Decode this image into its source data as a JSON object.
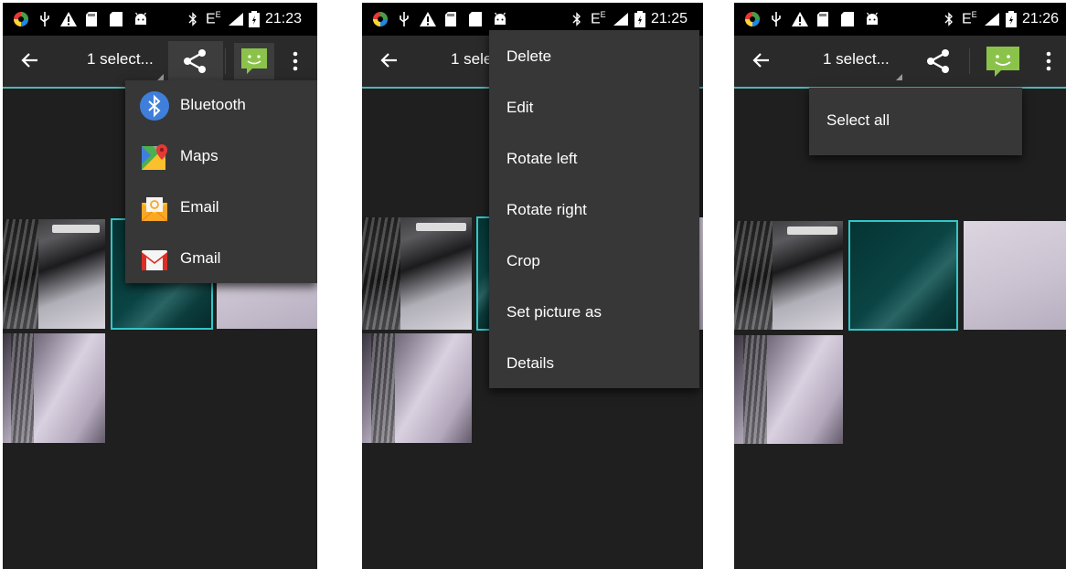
{
  "screens": [
    {
      "status": {
        "time": "21:23",
        "network": "E",
        "network_sup": "E"
      },
      "actionbar": {
        "title": "1 select..."
      },
      "share_menu": {
        "items": [
          {
            "label": "Bluetooth",
            "icon": "bluetooth-icon"
          },
          {
            "label": "Maps",
            "icon": "maps-icon"
          },
          {
            "label": "Email",
            "icon": "email-icon"
          },
          {
            "label": "Gmail",
            "icon": "gmail-icon"
          }
        ]
      }
    },
    {
      "status": {
        "time": "21:25",
        "network": "E",
        "network_sup": "E"
      },
      "actionbar": {
        "title": "1 sele"
      },
      "overflow_menu": {
        "items": [
          {
            "label": "Delete"
          },
          {
            "label": "Edit"
          },
          {
            "label": "Rotate left"
          },
          {
            "label": "Rotate right"
          },
          {
            "label": "Crop"
          },
          {
            "label": "Set picture as"
          },
          {
            "label": "Details"
          }
        ]
      }
    },
    {
      "status": {
        "time": "21:26",
        "network": "E",
        "network_sup": "E"
      },
      "actionbar": {
        "title": "1 select..."
      },
      "selection_menu": {
        "items": [
          {
            "label": "Select all"
          }
        ]
      }
    }
  ],
  "colors": {
    "accent": "#33c6c8",
    "actionbar": "#2a2a2a",
    "menu": "#373737",
    "message_app": "#8bc34a"
  },
  "status_icons": [
    "app-icon",
    "usb-icon",
    "warning-icon",
    "sd-card-icon",
    "sd-card-icon",
    "android-icon",
    "bluetooth-icon",
    "signal-icon",
    "battery-icon"
  ]
}
